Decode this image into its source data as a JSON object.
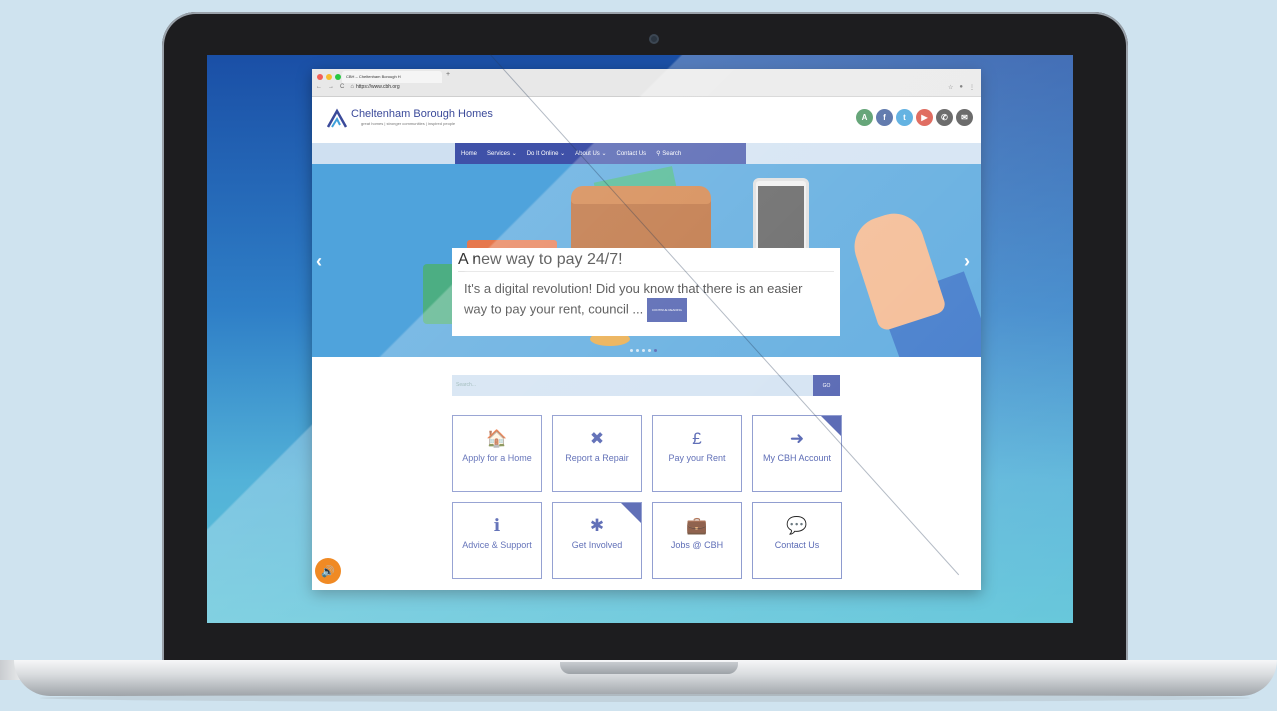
{
  "browser": {
    "tab_title": "CBH – Cheltenham Borough H",
    "new_tab": "+",
    "url": "https://www.cbh.org",
    "nav_buttons": [
      "←",
      "→",
      "C",
      "⌂"
    ],
    "tools": [
      "☆",
      "●",
      "⋮"
    ]
  },
  "site": {
    "logo_name": "Cheltenham Borough Homes",
    "logo_tagline": "great homes | stronger communities | inspired people",
    "social": [
      {
        "name": "accessibility-icon",
        "glyph": "A",
        "color": "#3f8f57"
      },
      {
        "name": "facebook-icon",
        "glyph": "f",
        "color": "#3b5a9a"
      },
      {
        "name": "twitter-icon",
        "glyph": "t",
        "color": "#3ea0db"
      },
      {
        "name": "youtube-icon",
        "glyph": "▶",
        "color": "#d94a3c"
      },
      {
        "name": "phone-icon",
        "glyph": "✆",
        "color": "#4a4a4a"
      },
      {
        "name": "email-icon",
        "glyph": "✉",
        "color": "#4a4a4a"
      }
    ],
    "nav": [
      "Home",
      "Services ⌄",
      "Do It Online ⌄",
      "About Us ⌄",
      "Contact Us",
      "⚲  Search"
    ]
  },
  "hero": {
    "title": "A new way to pay 24/7!",
    "body": "It's a digital revolution! Did you know that there is an easier way to pay your rent, council ...",
    "more_label": "CONTINUE READING",
    "prev": "‹",
    "next": "›"
  },
  "search": {
    "placeholder": "Search...",
    "button": "GO"
  },
  "tiles": [
    {
      "icon": "🏠",
      "label": "Apply for a Home"
    },
    {
      "icon": "✖",
      "label": "Report a Repair"
    },
    {
      "icon": "£",
      "label": "Pay your Rent"
    },
    {
      "icon": "➜",
      "label": "My CBH Account"
    },
    {
      "icon": "ℹ",
      "label": "Advice & Support"
    },
    {
      "icon": "✱",
      "label": "Get Involved"
    },
    {
      "icon": "💼",
      "label": "Jobs @ CBH"
    },
    {
      "icon": "💬",
      "label": "Contact Us"
    }
  ],
  "audio_icon": "🔊",
  "colors": {
    "primary": "#3f51a8",
    "hero_bg": "#4fa3dc",
    "nav_band": "#cfe0f1",
    "audio": "#f08a24"
  }
}
